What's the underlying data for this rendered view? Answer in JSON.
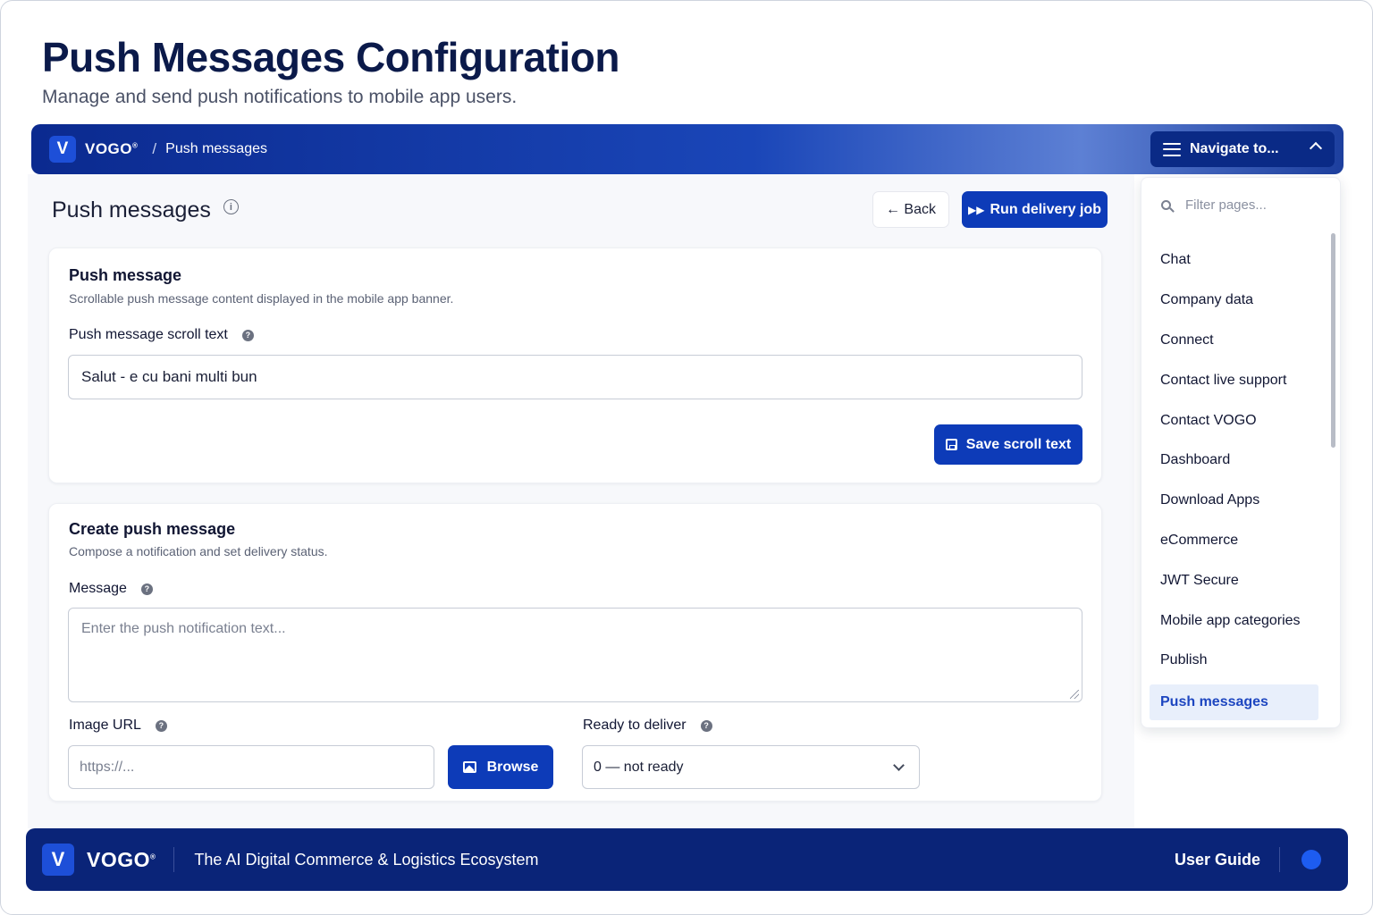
{
  "page": {
    "title": "Push Messages Configuration",
    "subtitle": "Manage and send push notifications to mobile app users."
  },
  "topbar": {
    "logo_letter": "V",
    "brand": "VOGO",
    "brand_mark": "®",
    "separator": "/",
    "breadcrumb": "Push messages",
    "nav_button": "Navigate to..."
  },
  "main": {
    "section_title": "Push messages",
    "back_label": "← Back",
    "run_label": "Run delivery job"
  },
  "card_scroll": {
    "title": "Push message",
    "description": "Scrollable push message content displayed in the mobile app banner.",
    "field_label": "Push message scroll text",
    "field_value": "Salut - e cu bani multi bun",
    "save_label": "Save scroll text"
  },
  "card_create": {
    "title": "Create push message",
    "description": "Compose a notification and set delivery status.",
    "message_label": "Message",
    "message_placeholder": "Enter the push notification text...",
    "image_label": "Image URL",
    "image_placeholder": "https://...",
    "browse_label": "Browse",
    "ready_label": "Ready to deliver",
    "ready_value": "0 — not ready"
  },
  "nav_panel": {
    "filter_placeholder": "Filter pages...",
    "items": [
      "Chat",
      "Company data",
      "Connect",
      "Contact live support",
      "Contact VOGO",
      "Dashboard",
      "Download Apps",
      "eCommerce",
      "JWT Secure",
      "Mobile app categories",
      "Publish",
      "Push messages"
    ],
    "active_item": "Push messages"
  },
  "footer": {
    "logo_letter": "V",
    "brand": "VOGO",
    "brand_mark": "®",
    "tagline": "The AI Digital Commerce & Logistics Ecosystem",
    "user_guide": "User Guide"
  },
  "colors": {
    "primary": "#0d3bb8",
    "topbar": "#0b2a8f",
    "footer": "#0a2478",
    "active_nav_bg": "#e8effb",
    "status_dot": "#1d5cf0"
  }
}
